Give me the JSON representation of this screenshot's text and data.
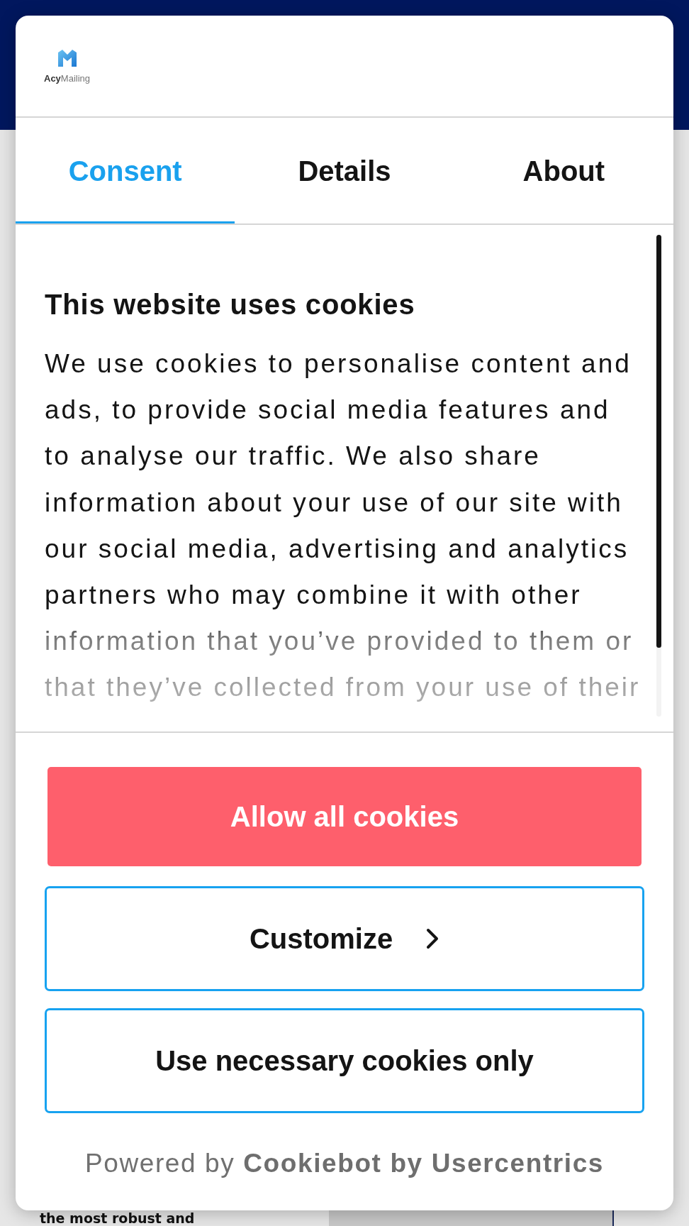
{
  "logo": {
    "text": "**Acy**Mailing"
  },
  "tabs": [
    {
      "label": "Consent",
      "selected": true
    },
    {
      "label": "Details",
      "selected": false
    },
    {
      "label": "About",
      "selected": false
    }
  ],
  "content": {
    "heading": "This website uses cookies",
    "body": "We use cookies to personalise content and ads, to provide social media features and to analyse our traffic. We also share information about your use of our site with our social media, advertising and analytics partners who may combine it with other information that you’ve provided to them or that they’ve collected from your use of their"
  },
  "buttons": [
    {
      "label": "Allow all cookies",
      "kind": "primary"
    },
    {
      "label": "Customize",
      "kind": "chevron"
    },
    {
      "label": "Use necessary cookies only",
      "kind": "outline"
    }
  ],
  "footer": {
    "text": "Powered by",
    "link": "Cookiebot by Usercentrics"
  },
  "page": {
    "text": "the most robust and"
  }
}
